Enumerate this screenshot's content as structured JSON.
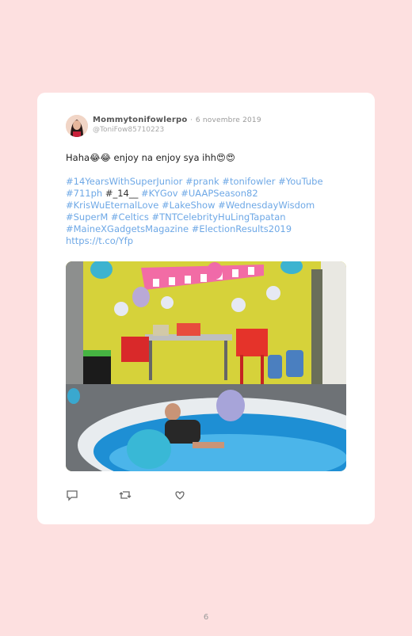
{
  "tweet": {
    "display_name": "Mommytonifowlerpo",
    "separator": "·",
    "date": "6 novembre 2019",
    "handle": "@ToniFow85710223",
    "text": "Haha😂😂 enjoy na enjoy sya ihh😍😍",
    "tags_line1": "#14YearsWithSuperJunior #prank #tonifowler #YouTube",
    "tags_line2_a": "#711ph",
    "tags_line2_b": " #_14__ ",
    "tags_line2_c": "#KYGov #UAAPSeason82",
    "tags_line3": "#KrisWuEternalLove #LakeShow #WednesdayWisdom",
    "tags_line4": "#SuperM #Celtics #TNTCelebrityHuLingTapatan",
    "tags_line5": "#MaineXGadgetsMagazine #ElectionResults2019",
    "link": "https://t.co/Yfp"
  },
  "actions": {
    "reply_icon": "reply-icon",
    "retweet_icon": "retweet-icon",
    "like_icon": "heart-icon"
  },
  "page_number": "6"
}
